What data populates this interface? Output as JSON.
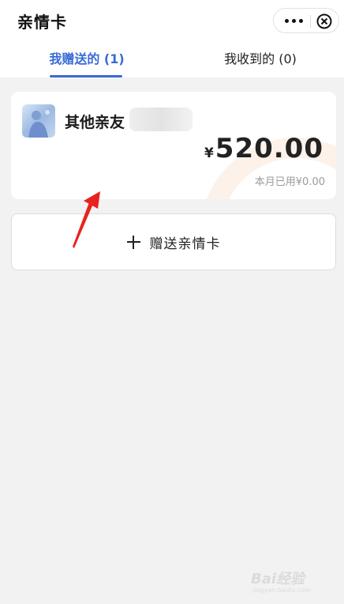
{
  "header": {
    "title": "亲情卡",
    "more_icon": "more-dots-icon",
    "close_icon": "close-circle-icon"
  },
  "tabs": [
    {
      "label": "我赠送的 (1)",
      "active": true
    },
    {
      "label": "我收到的 (0)",
      "active": false
    }
  ],
  "card": {
    "recipient_label": "其他亲友",
    "currency": "¥",
    "amount": "520.00",
    "spent_text": "本月已用¥0.00"
  },
  "add_button": {
    "label": "赠送亲情卡",
    "icon": "plus-icon"
  },
  "watermark": {
    "text": "Bai经验",
    "sub": "jingyan.baidu.com"
  },
  "colors": {
    "accent": "#3a6ad6",
    "annotation_arrow": "#e8231f",
    "background": "#f2f2f2"
  }
}
